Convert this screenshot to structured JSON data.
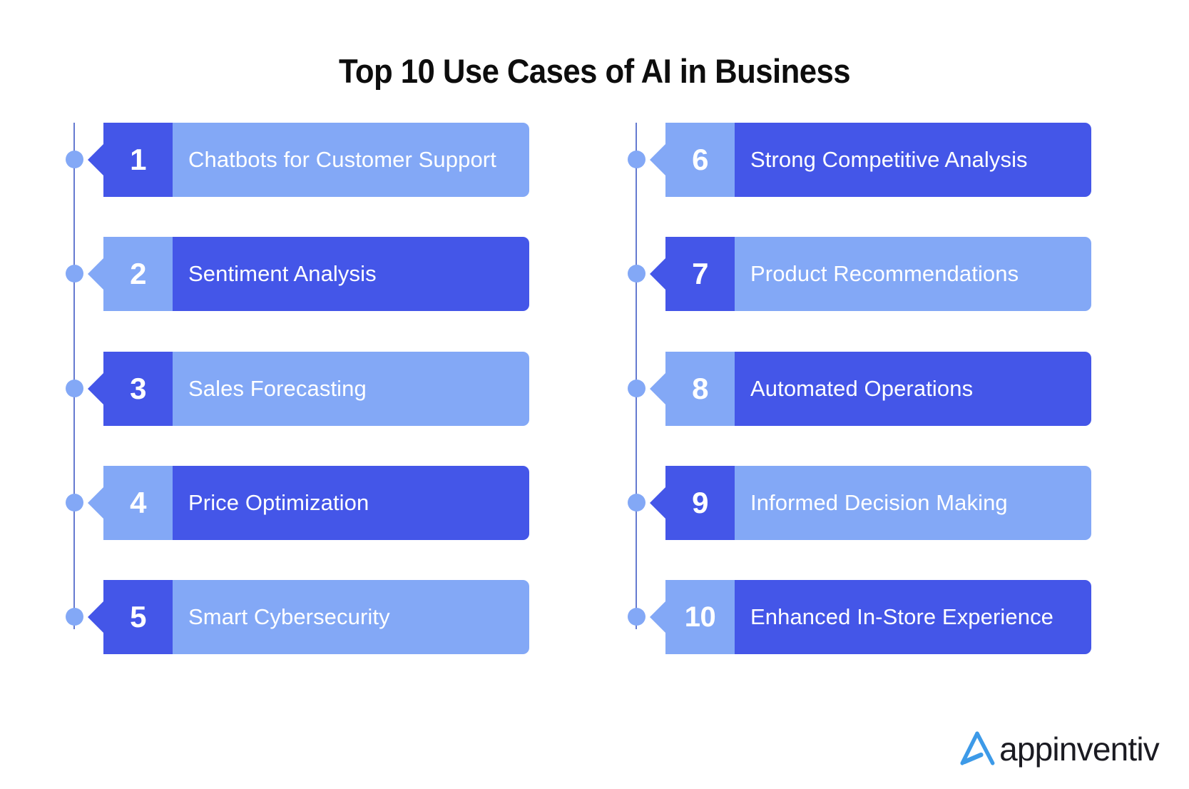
{
  "page": {
    "title": "Top 10 Use Cases of AI in Business",
    "background_color": "#ffffff"
  },
  "theme": {
    "dark_blue": "#4456e8",
    "light_blue": "#83a8f6",
    "line_color": "#4a63c8",
    "text_color": "#ffffff",
    "title_color": "#0d0d0d"
  },
  "columns": [
    {
      "name": "left-column",
      "items": [
        {
          "number": "1",
          "label": "Chatbots for Customer Support",
          "style": "dark-number"
        },
        {
          "number": "2",
          "label": "Sentiment Analysis",
          "style": "light-number"
        },
        {
          "number": "3",
          "label": "Sales Forecasting",
          "style": "dark-number"
        },
        {
          "number": "4",
          "label": "Price Optimization",
          "style": "light-number"
        },
        {
          "number": "5",
          "label": "Smart Cybersecurity",
          "style": "dark-number"
        }
      ]
    },
    {
      "name": "right-column",
      "items": [
        {
          "number": "6",
          "label": "Strong Competitive Analysis",
          "style": "light-number"
        },
        {
          "number": "7",
          "label": "Product Recommendations",
          "style": "dark-number"
        },
        {
          "number": "8",
          "label": "Automated Operations",
          "style": "light-number"
        },
        {
          "number": "9",
          "label": "Informed Decision Making",
          "style": "dark-number"
        },
        {
          "number": "10",
          "label": "Enhanced In-Store Experience",
          "style": "light-number"
        }
      ]
    }
  ],
  "logo": {
    "wordmark": "appinventiv",
    "mark_color": "#3d9ae8",
    "word_color": "#1b1b22"
  }
}
